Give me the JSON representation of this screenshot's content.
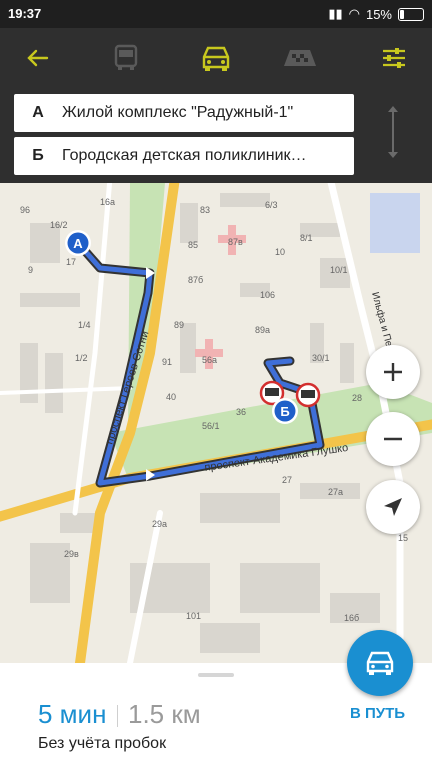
{
  "status_bar": {
    "time": "19:37",
    "battery": "15%"
  },
  "toolbar": {
    "back_icon": "arrow-left-icon",
    "modes": [
      "bus-icon",
      "car-icon",
      "taxi-icon"
    ],
    "active_mode": "car-icon",
    "settings_icon": "sliders-icon"
  },
  "route": {
    "from_letter": "А",
    "from_value": "Жилой комплекс \"Радужный-1\"",
    "to_letter": "Б",
    "to_value": "Городская детская поликлиник…"
  },
  "map": {
    "streets": [
      "проспект Героев Сотни",
      "проспект Академика Глушко",
      "Ильфа и Петрова"
    ],
    "house_numbers": [
      "96",
      "16/2",
      "9",
      "17",
      "16а",
      "83",
      "6/3",
      "8/1",
      "87в",
      "85",
      "10",
      "10/1",
      "87б",
      "1/4",
      "106",
      "89",
      "89а",
      "1/2",
      "91",
      "56а",
      "30/1",
      "40",
      "36",
      "28",
      "56/1",
      "27",
      "27а",
      "29а",
      "29в",
      "101",
      "16б",
      "15"
    ],
    "marker_a": "А",
    "marker_b": "Б"
  },
  "summary": {
    "time": "5 мин",
    "distance": "1.5 км",
    "traffic_note": "Без учёта пробок",
    "go_label": "В ПУТЬ"
  },
  "colors": {
    "accent_yellow": "#c8c81e",
    "route_blue": "#3f6fd8",
    "accent_blue": "#1a8fd1"
  }
}
